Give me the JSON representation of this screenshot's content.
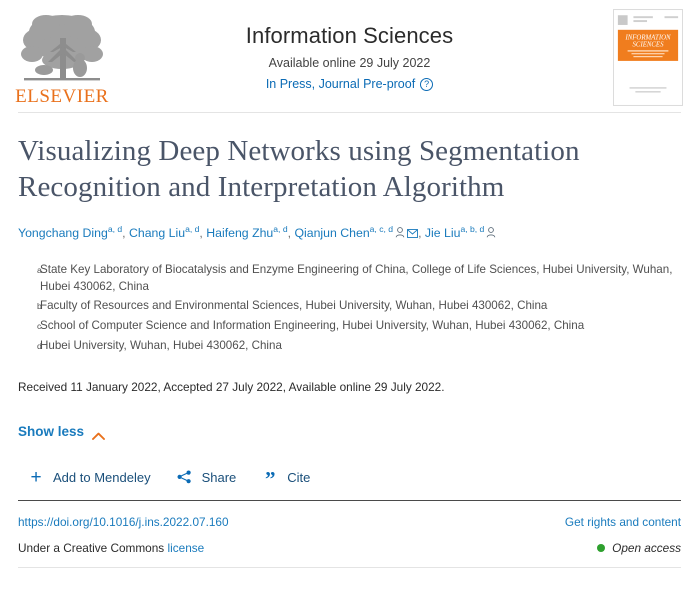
{
  "header": {
    "publisher": "ELSEVIER",
    "publisher_logo_icon": "elsevier-tree-logo",
    "journal_name": "Information Sciences",
    "availability": "Available online 29 July 2022",
    "press_status": "In Press, Journal Pre-proof",
    "help_icon": "question-mark-circle-icon",
    "cover": {
      "alt": "Information Sciences journal cover",
      "line1": "INFORMATION",
      "line2": "SCIENCES"
    }
  },
  "article": {
    "title": "Visualizing Deep Networks using Segmentation Recognition and Interpretation Algorithm",
    "authors": [
      {
        "name": "Yongchang Ding",
        "affiliations": "a, d",
        "icons": []
      },
      {
        "name": "Chang Liu",
        "affiliations": "a, d",
        "icons": []
      },
      {
        "name": "Haifeng Zhu",
        "affiliations": "a, d",
        "icons": []
      },
      {
        "name": "Qianjun Chen",
        "affiliations": "a, c, d",
        "icons": [
          "person-icon",
          "envelope-icon"
        ]
      },
      {
        "name": "Jie Liu",
        "affiliations": "a, b, d",
        "icons": [
          "person-icon"
        ]
      }
    ],
    "affiliations": [
      {
        "mark": "a",
        "text": "State Key Laboratory of Biocatalysis and Enzyme Engineering of China, College of Life Sciences, Hubei University, Wuhan, Hubei 430062, China"
      },
      {
        "mark": "b",
        "text": "Faculty of Resources and Environmental Sciences, Hubei University, Wuhan, Hubei 430062, China"
      },
      {
        "mark": "c",
        "text": "School of Computer Science and Information Engineering, Hubei University, Wuhan, Hubei 430062, China"
      },
      {
        "mark": "d",
        "text": "Hubei University, Wuhan, Hubei 430062, China"
      }
    ],
    "history": "Received 11 January 2022, Accepted 27 July 2022, Available online 29 July 2022.",
    "show_less_label": "Show less",
    "show_less_icon": "chevron-up-icon"
  },
  "actions": [
    {
      "label": "Add to Mendeley",
      "icon": "plus-icon"
    },
    {
      "label": "Share",
      "icon": "share-nodes-icon"
    },
    {
      "label": "Cite",
      "icon": "quotation-marks-icon"
    }
  ],
  "footer": {
    "doi": "https://doi.org/10.1016/j.ins.2022.07.160",
    "rights": "Get rights and content",
    "license_prefix": "Under a Creative Commons",
    "license_link": "license",
    "open_access": "Open access",
    "open_access_icon": "green-dot-icon"
  },
  "colors": {
    "link_blue": "#1a7bbd",
    "status_blue": "#0b6bb5",
    "elsevier_orange": "#e9711c",
    "title_slate": "#4a5568",
    "open_access_green": "#2ea02e",
    "cover_orange": "#f07d1e"
  }
}
